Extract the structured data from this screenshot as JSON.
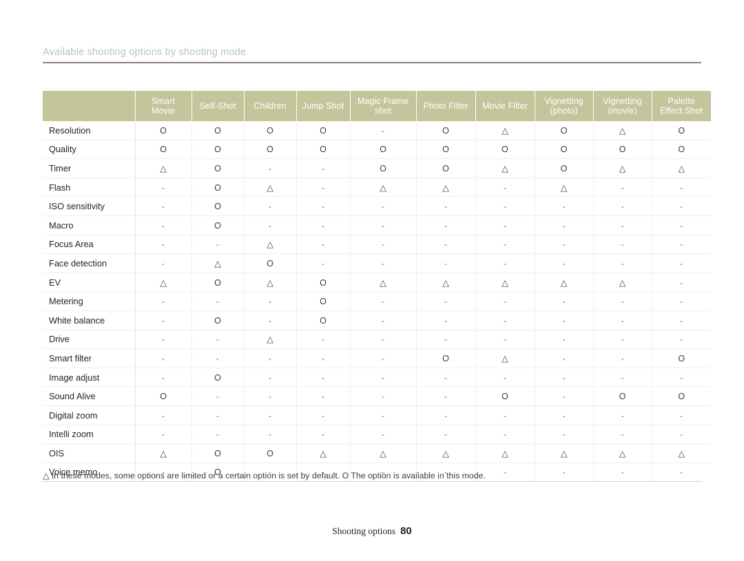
{
  "running_head": {
    "title": "Available shooting options by shooting mode"
  },
  "table": {
    "corner_label": "",
    "columns": [
      {
        "line1": "Smart",
        "line2": "Movie"
      },
      {
        "line1": "Self-Shot",
        "line2": ""
      },
      {
        "line1": "Children",
        "line2": ""
      },
      {
        "line1": "Jump Shot",
        "line2": ""
      },
      {
        "line1": "Magic Frame",
        "line2": "shot"
      },
      {
        "line1": "Photo Filter",
        "line2": ""
      },
      {
        "line1": "Movie Filter",
        "line2": ""
      },
      {
        "line1": "Vignetting",
        "line2": "(photo)"
      },
      {
        "line1": "Vignetting",
        "line2": "(movie)"
      },
      {
        "line1": "Palette",
        "line2": "Effect Shot"
      }
    ],
    "rows": [
      {
        "label": "Resolution",
        "cells": [
          "O",
          "O",
          "O",
          "O",
          "-",
          "O",
          "△",
          "O",
          "△",
          "O"
        ]
      },
      {
        "label": "Quality",
        "cells": [
          "O",
          "O",
          "O",
          "O",
          "O",
          "O",
          "O",
          "O",
          "O",
          "O"
        ]
      },
      {
        "label": "Timer",
        "cells": [
          "△",
          "O",
          "-",
          "-",
          "O",
          "O",
          "△",
          "O",
          "△",
          "△"
        ]
      },
      {
        "label": "Flash",
        "cells": [
          "-",
          "O",
          "△",
          "-",
          "△",
          "△",
          "-",
          "△",
          "-",
          "-"
        ]
      },
      {
        "label": "ISO sensitivity",
        "cells": [
          "-",
          "O",
          "-",
          "-",
          "-",
          "-",
          "-",
          "-",
          "-",
          "-"
        ]
      },
      {
        "label": "Macro",
        "cells": [
          "-",
          "O",
          "-",
          "-",
          "-",
          "-",
          "-",
          "-",
          "-",
          "-"
        ]
      },
      {
        "label": "Focus Area",
        "cells": [
          "-",
          "-",
          "△",
          "-",
          "-",
          "-",
          "-",
          "-",
          "-",
          "-"
        ]
      },
      {
        "label": "Face detection",
        "cells": [
          "-",
          "△",
          "O",
          "-",
          "-",
          "-",
          "-",
          "-",
          "-",
          "-"
        ]
      },
      {
        "label": "EV",
        "cells": [
          "△",
          "O",
          "△",
          "O",
          "△",
          "△",
          "△",
          "△",
          "△",
          "-"
        ]
      },
      {
        "label": "Metering",
        "cells": [
          "-",
          "-",
          "-",
          "O",
          "-",
          "-",
          "-",
          "-",
          "-",
          "-"
        ]
      },
      {
        "label": "White balance",
        "cells": [
          "-",
          "O",
          "-",
          "O",
          "-",
          "-",
          "-",
          "-",
          "-",
          "-"
        ]
      },
      {
        "label": "Drive",
        "cells": [
          "-",
          "-",
          "△",
          "-",
          "-",
          "-",
          "-",
          "-",
          "-",
          "-"
        ]
      },
      {
        "label": "Smart filter",
        "cells": [
          "-",
          "-",
          "-",
          "-",
          "-",
          "O",
          "△",
          "-",
          "-",
          "O"
        ]
      },
      {
        "label": "Image adjust",
        "cells": [
          "-",
          "O",
          "-",
          "-",
          "-",
          "-",
          "-",
          "-",
          "-",
          "-"
        ]
      },
      {
        "label": "Sound Alive",
        "cells": [
          "O",
          "-",
          "-",
          "-",
          "-",
          "-",
          "O",
          "-",
          "O",
          "O"
        ]
      },
      {
        "label": "Digital zoom",
        "cells": [
          "-",
          "-",
          "-",
          "-",
          "-",
          "-",
          "-",
          "-",
          "-",
          "-"
        ]
      },
      {
        "label": "Intelli zoom",
        "cells": [
          "-",
          "-",
          "-",
          "-",
          "-",
          "-",
          "-",
          "-",
          "-",
          "-"
        ]
      },
      {
        "label": "OIS",
        "cells": [
          "△",
          "O",
          "O",
          "△",
          "△",
          "△",
          "△",
          "△",
          "△",
          "△"
        ]
      },
      {
        "label": "Voice memo",
        "cells": [
          "-",
          "O",
          "-",
          "-",
          "-",
          "-",
          "-",
          "-",
          "-",
          "-"
        ]
      }
    ]
  },
  "footnote": {
    "text": "△ In these modes, some options are limited or a certain option is set by default. O The option is available in this mode."
  },
  "page_footer": {
    "label": "Shooting options",
    "number": "80"
  },
  "colors": {
    "header_bg": "#c5c59c",
    "header_text": "#ffffff",
    "running_head_text": "#b9c3bc",
    "rule": "#8d7f74",
    "grid": "#efeee8"
  }
}
